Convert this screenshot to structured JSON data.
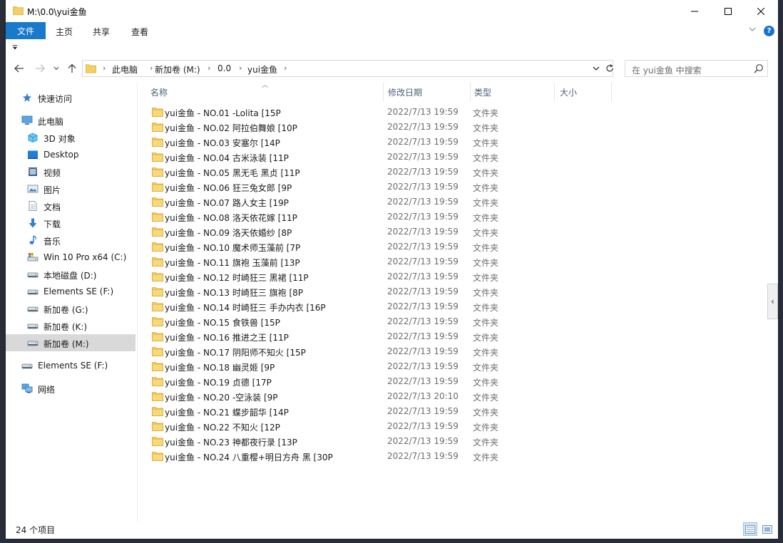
{
  "window": {
    "title": "M:\\0.0\\yui金鱼"
  },
  "ribbon": {
    "tabs": {
      "file": "文件",
      "home": "主页",
      "share": "共享",
      "view": "查看"
    },
    "help": "?"
  },
  "address": {
    "crumbs": [
      "此电脑",
      "新加卷 (M:)",
      "0.0",
      "yui金鱼"
    ],
    "search_placeholder": "在 yui金鱼 中搜索"
  },
  "nav": {
    "items": [
      {
        "label": "快速访问",
        "icon": "star-icon"
      },
      {
        "label": "此电脑",
        "icon": "computer-icon"
      },
      {
        "label": "3D 对象",
        "icon": "cube-3d-icon"
      },
      {
        "label": "Desktop",
        "icon": "desktop-icon"
      },
      {
        "label": "视频",
        "icon": "video-icon"
      },
      {
        "label": "图片",
        "icon": "pictures-icon"
      },
      {
        "label": "文档",
        "icon": "document-icon"
      },
      {
        "label": "下载",
        "icon": "download-icon"
      },
      {
        "label": "音乐",
        "icon": "music-icon"
      },
      {
        "label": "Win 10 Pro x64 (C:)",
        "icon": "system-drive-icon"
      },
      {
        "label": "本地磁盘 (D:)",
        "icon": "drive-icon"
      },
      {
        "label": "Elements SE (F:)",
        "icon": "drive-icon"
      },
      {
        "label": "新加卷 (G:)",
        "icon": "drive-icon"
      },
      {
        "label": "新加卷 (K:)",
        "icon": "drive-icon"
      },
      {
        "label": "新加卷 (M:)",
        "icon": "drive-icon"
      },
      {
        "label": "Elements SE (F:)",
        "icon": "drive-icon"
      },
      {
        "label": "网络",
        "icon": "network-icon"
      }
    ]
  },
  "columns": {
    "name": "名称",
    "date": "修改日期",
    "type": "类型",
    "size": "大小"
  },
  "files": [
    {
      "name": "yui金鱼 - NO.01 -Lolita [15P",
      "date": "2022/7/13 19:59",
      "type": "文件夹"
    },
    {
      "name": "yui金鱼 - NO.02 阿拉伯舞娘 [10P",
      "date": "2022/7/13 19:59",
      "type": "文件夹"
    },
    {
      "name": "yui金鱼 - NO.03 安塞尔 [14P",
      "date": "2022/7/13 19:59",
      "type": "文件夹"
    },
    {
      "name": "yui金鱼 - NO.04 古米泳装 [11P",
      "date": "2022/7/13 19:59",
      "type": "文件夹"
    },
    {
      "name": "yui金鱼 - NO.05 黑无毛 黑贞 [11P",
      "date": "2022/7/13 19:59",
      "type": "文件夹"
    },
    {
      "name": "yui金鱼 - NO.06 狂三兔女郎 [9P",
      "date": "2022/7/13 19:59",
      "type": "文件夹"
    },
    {
      "name": "yui金鱼 - NO.07 路人女主 [19P",
      "date": "2022/7/13 19:59",
      "type": "文件夹"
    },
    {
      "name": "yui金鱼 - NO.08 洛天依花嫁 [11P",
      "date": "2022/7/13 19:59",
      "type": "文件夹"
    },
    {
      "name": "yui金鱼 - NO.09 洛天依婚纱 [8P",
      "date": "2022/7/13 19:59",
      "type": "文件夹"
    },
    {
      "name": "yui金鱼 - NO.10 魔术师玉藻前 [7P",
      "date": "2022/7/13 19:59",
      "type": "文件夹"
    },
    {
      "name": "yui金鱼 - NO.11 旗袍 玉藻前 [13P",
      "date": "2022/7/13 19:59",
      "type": "文件夹"
    },
    {
      "name": "yui金鱼 - NO.12 时崎狂三 黑裙 [11P",
      "date": "2022/7/13 19:59",
      "type": "文件夹"
    },
    {
      "name": "yui金鱼 - NO.13 时崎狂三 旗袍 [8P",
      "date": "2022/7/13 19:59",
      "type": "文件夹"
    },
    {
      "name": "yui金鱼 - NO.14 时崎狂三 手办内衣 [16P",
      "date": "2022/7/13 19:59",
      "type": "文件夹"
    },
    {
      "name": "yui金鱼 - NO.15 食铁兽 [15P",
      "date": "2022/7/13 19:59",
      "type": "文件夹"
    },
    {
      "name": "yui金鱼 - NO.16 推进之王 [11P",
      "date": "2022/7/13 19:59",
      "type": "文件夹"
    },
    {
      "name": "yui金鱼 - NO.17 阴阳师不知火 [15P",
      "date": "2022/7/13 19:59",
      "type": "文件夹"
    },
    {
      "name": "yui金鱼 - NO.18 幽灵姬 [9P",
      "date": "2022/7/13 19:59",
      "type": "文件夹"
    },
    {
      "name": "yui金鱼 - NO.19 贞德 [17P",
      "date": "2022/7/13 19:59",
      "type": "文件夹"
    },
    {
      "name": "yui金鱼 - NO.20 -空泳装 [9P",
      "date": "2022/7/13 20:10",
      "type": "文件夹"
    },
    {
      "name": "yui金鱼 - NO.21 蝶步韶华 [14P",
      "date": "2022/7/13 19:59",
      "type": "文件夹"
    },
    {
      "name": "yui金鱼 - NO.22 不知火 [12P",
      "date": "2022/7/13 19:59",
      "type": "文件夹"
    },
    {
      "name": "yui金鱼 - NO.23 神都夜行录 [13P",
      "date": "2022/7/13 19:59",
      "type": "文件夹"
    },
    {
      "name": "yui金鱼 - NO.24 八重樱+明日方舟 黑 [30P",
      "date": "2022/7/13 19:59",
      "type": "文件夹"
    }
  ],
  "status": {
    "item_count": "24 个项目"
  },
  "colors": {
    "accent": "#1979ca",
    "folder": "#f5cf62",
    "selected": "#d9d9d9"
  }
}
